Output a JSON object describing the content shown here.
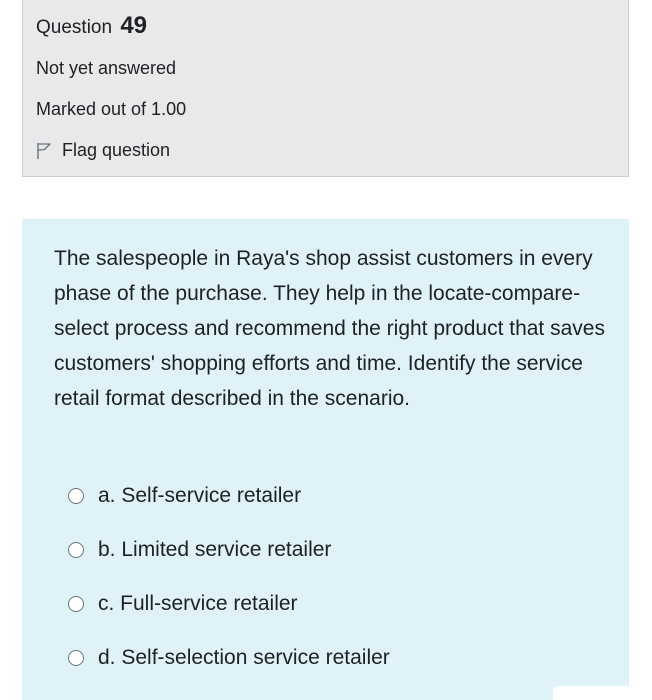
{
  "info": {
    "question_prefix": "Question",
    "question_number": "49",
    "status": "Not yet answered",
    "marks": "Marked out of 1.00",
    "flag_label": "Flag question",
    "flag_icon": "flag-icon"
  },
  "question": {
    "text": "The salespeople in Raya's shop assist customers in every phase of the purchase. They help in the locate-compare-select process and recommend the right product that saves customers' shopping efforts and time. Identify the service retail format described in the scenario."
  },
  "answers": [
    {
      "label": "a. Self-service retailer"
    },
    {
      "label": "b. Limited service retailer"
    },
    {
      "label": "c. Full-service retailer"
    },
    {
      "label": "d. Self-selection service retailer"
    }
  ]
}
